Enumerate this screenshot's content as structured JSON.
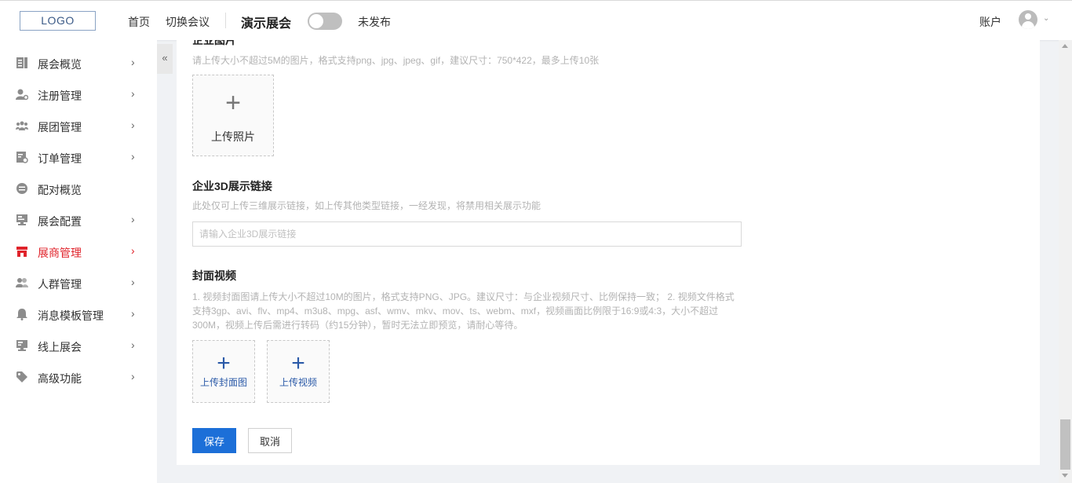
{
  "header": {
    "logo_text": "LOGO",
    "nav_home": "首页",
    "nav_switch": "切换会议",
    "event_title": "演示展会",
    "publish_status": "未发布",
    "account_label": "账户"
  },
  "sidebar": {
    "collapse_glyph": "«",
    "items": [
      {
        "label": "展会概览",
        "icon": "document-icon",
        "has_children": true
      },
      {
        "label": "注册管理",
        "icon": "user-settings-icon",
        "has_children": true
      },
      {
        "label": "展团管理",
        "icon": "group-icon",
        "has_children": true
      },
      {
        "label": "订单管理",
        "icon": "order-icon",
        "has_children": true
      },
      {
        "label": "配对概览",
        "icon": "match-icon",
        "has_children": false
      },
      {
        "label": "展会配置",
        "icon": "config-icon",
        "has_children": true
      },
      {
        "label": "展商管理",
        "icon": "store-icon",
        "has_children": true,
        "active": true
      },
      {
        "label": "人群管理",
        "icon": "people-icon",
        "has_children": true
      },
      {
        "label": "消息模板管理",
        "icon": "bell-icon",
        "has_children": true
      },
      {
        "label": "线上展会",
        "icon": "monitor-icon",
        "has_children": true
      },
      {
        "label": "高级功能",
        "icon": "tag-icon",
        "has_children": true
      }
    ],
    "active_color": "#e0232b"
  },
  "main": {
    "photo_section": {
      "title": "企业图片",
      "hint": "请上传大小不超过5M的图片，格式支持png、jpg、jpeg、gif，建议尺寸：750*422，最多上传10张",
      "upload_label": "上传照片"
    },
    "link_section": {
      "title": "企业3D展示链接",
      "hint": "此处仅可上传三维展示链接，如上传其他类型链接，一经发现，将禁用相关展示功能",
      "input_value": "",
      "input_placeholder": "请输入企业3D展示链接"
    },
    "video_section": {
      "title": "封面视频",
      "hint_lines": [
        "1. 视频封面图请上传大小不超过10M的图片，格式支持PNG、JPG。建议尺寸：与企业视频尺寸、比例保持一致； 2. 视频文件格式",
        "支持3gp、avi、flv、mp4、m3u8、mpg、asf、wmv、mkv、mov、ts、webm、mxf，视频画面比例限于16:9或4:3，大小不超过",
        "300M，视频上传后需进行转码（约15分钟），暂时无法立即预览，请耐心等待。"
      ],
      "upload_cover_label": "上传封面图",
      "upload_video_label": "上传视频"
    },
    "actions": {
      "save_label": "保存",
      "cancel_label": "取消"
    }
  },
  "colors": {
    "primary": "#1c6fd8",
    "upload_text_blue": "#2b5aa8"
  }
}
